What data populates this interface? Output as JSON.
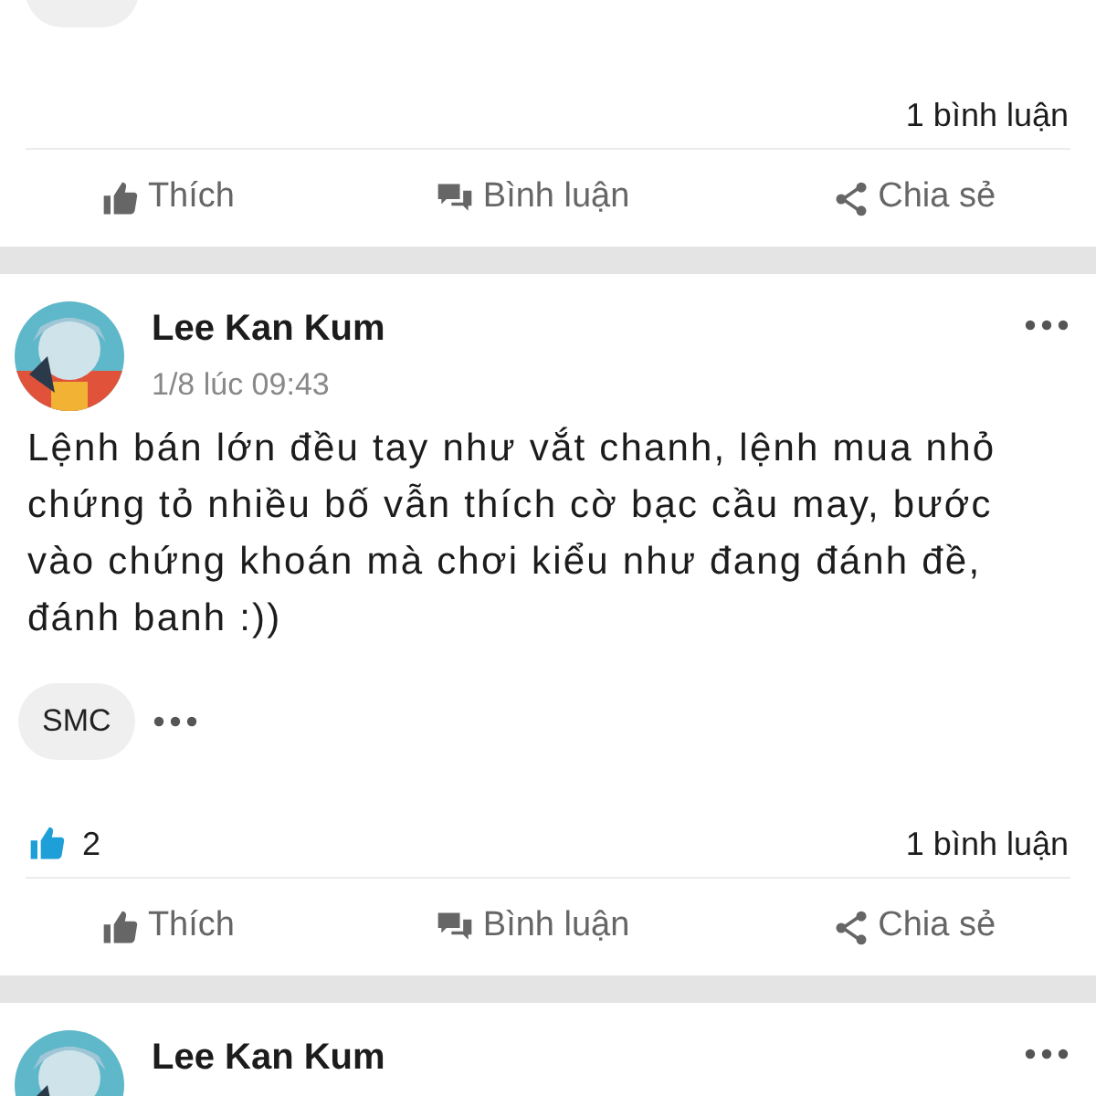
{
  "posts": [
    {
      "kind": "partial",
      "comments": "1 bình luận",
      "actions": [
        {
          "kind": "like",
          "label": "Thích"
        },
        {
          "kind": "comment",
          "label": "Bình luận"
        },
        {
          "kind": "share",
          "label": "Chia sẻ"
        }
      ]
    },
    {
      "kind": "full",
      "author": "Lee Kan Kum",
      "time": "1/8 lúc 09:43",
      "text": "Lệnh bán lớn đều tay như vắt chanh, lệnh mua nhỏ chứng tỏ nhiều bố vẫn thích cờ bạc cầu may, bước vào chứng khoán mà chơi kiểu như đang đánh đề, đánh banh :))",
      "tags": [
        "SMC"
      ],
      "likes": "2",
      "comments": "1 bình luận",
      "actions": [
        {
          "kind": "like",
          "label": "Thích"
        },
        {
          "kind": "comment",
          "label": "Bình luận"
        },
        {
          "kind": "share",
          "label": "Chia sẻ"
        }
      ]
    },
    {
      "kind": "header",
      "author": "Lee Kan Kum"
    }
  ]
}
